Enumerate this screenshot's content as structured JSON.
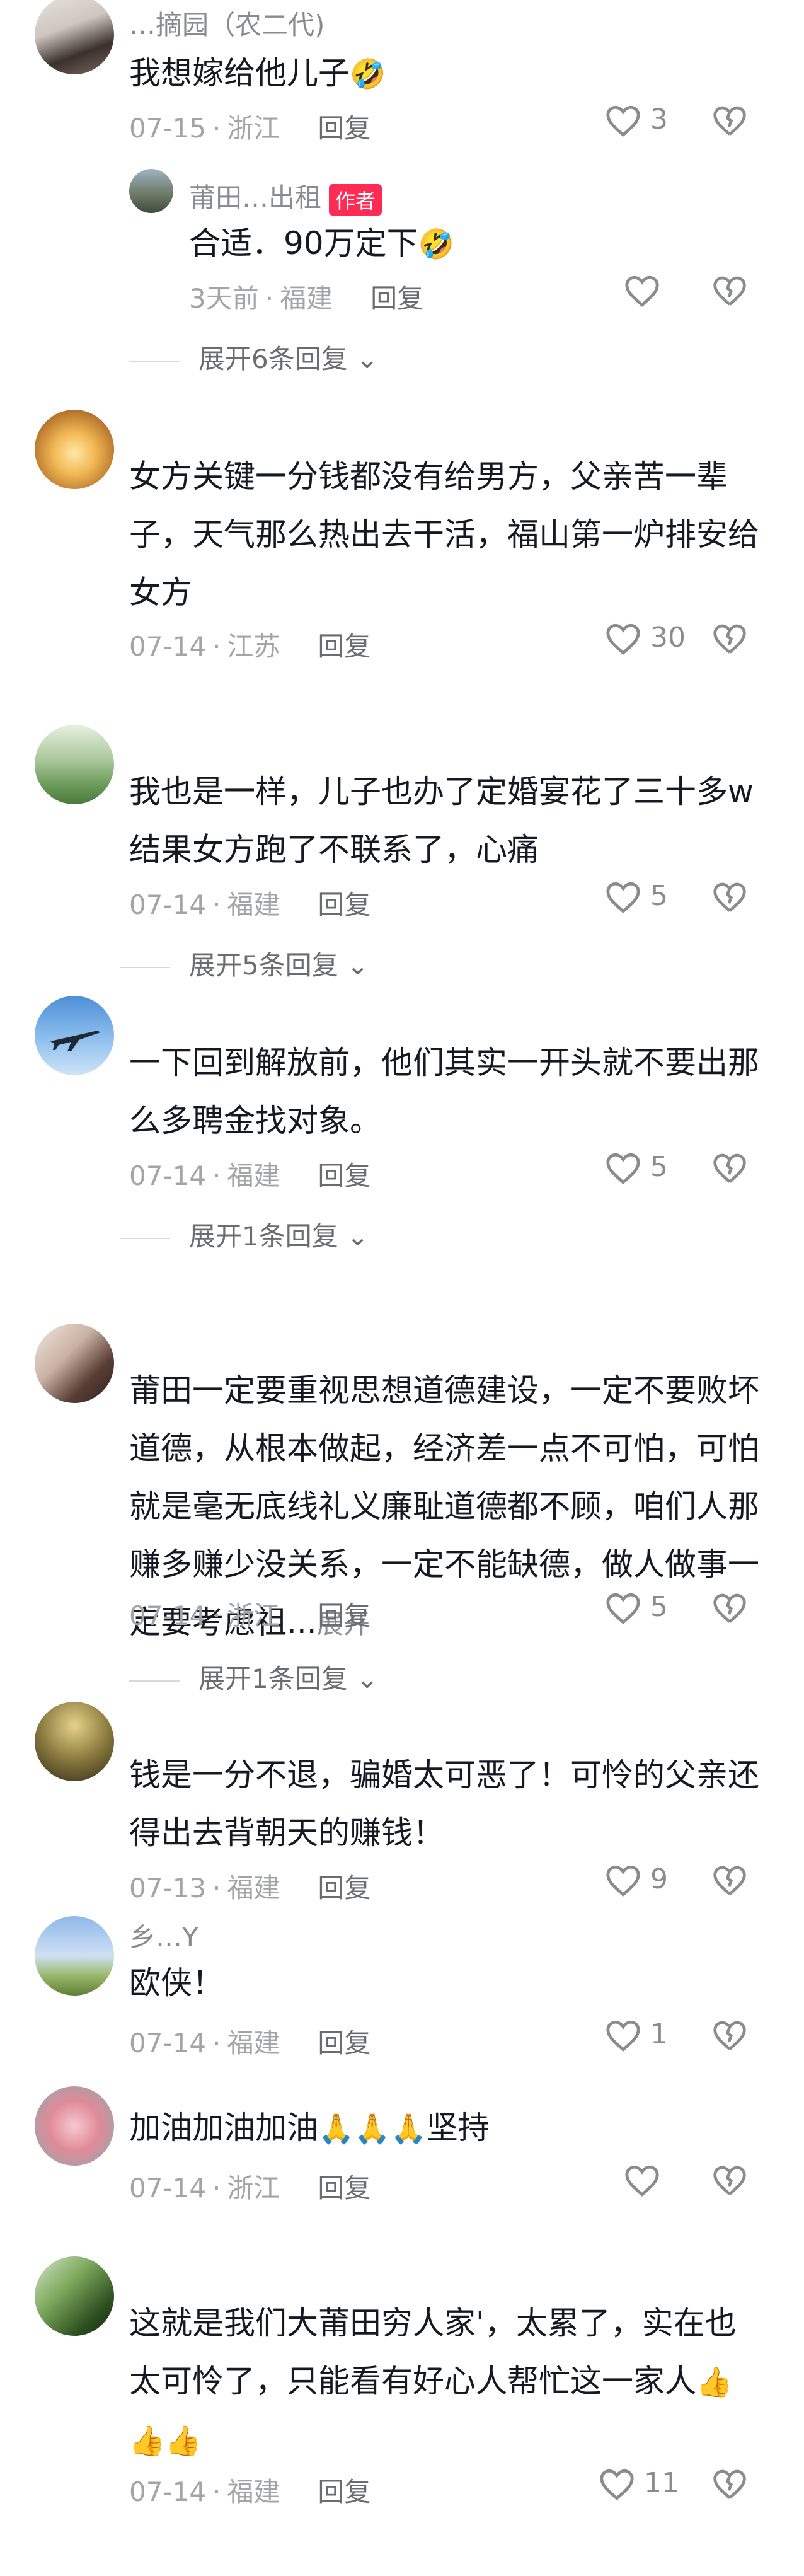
{
  "comments": [
    {
      "username": "…摘园（农二代)",
      "text": "我想嫁给他儿子",
      "emoji": "🤣",
      "date": "07-15",
      "location": "浙江",
      "reply": "回复",
      "likes": "3",
      "reply_item": {
        "username": "莆田…出租",
        "author_tag": "作者",
        "text": "合适．90万定下",
        "emoji": "🤣",
        "date": "3天前",
        "location": "福建",
        "reply": "回复"
      },
      "expand": "展开6条回复"
    },
    {
      "username": "",
      "text": "女方关键一分钱都没有给男方，父亲苦一辈子，天气那么热出去干活，福山第一炉排安给女方",
      "date": "07-14",
      "location": "江苏",
      "reply": "回复",
      "likes": "30"
    },
    {
      "username": "",
      "text": "我也是一样，儿子也办了定婚宴花了三十多w结果女方跑了不联系了，心痛",
      "date": "07-14",
      "location": "福建",
      "reply": "回复",
      "likes": "5",
      "expand": "展开5条回复"
    },
    {
      "username": "",
      "text": "一下回到解放前，他们其实一开头就不要出那么多聘金找对象。",
      "date": "07-14",
      "location": "福建",
      "reply": "回复",
      "likes": "5",
      "expand": "展开1条回复"
    },
    {
      "username": "",
      "text": "莆田一定要重视思想道德建设，一定不要败坏道德，从根本做起，经济差一点不可怕，可怕就是毫无底线礼义廉耻道德都不顾，咱们人那赚多赚少没关系，一定不能缺德，做人做事一定要考虑祖...",
      "more": "展开",
      "date": "07-14",
      "location": "浙江",
      "reply": "回复",
      "likes": "5",
      "expand": "展开1条回复"
    },
    {
      "username": "",
      "text": "钱是一分不退，骗婚太可恶了！可怜的父亲还得出去背朝天的赚钱！",
      "date": "07-13",
      "location": "福建",
      "reply": "回复",
      "likes": "9"
    },
    {
      "username": "乡…Y",
      "text": "欧侠！",
      "date": "07-14",
      "location": "福建",
      "reply": "回复",
      "likes": "1"
    },
    {
      "username": "",
      "text": "加油加油加油",
      "emoji": "🙏🙏🙏",
      "text_after": "坚持",
      "date": "07-14",
      "location": "浙江",
      "reply": "回复",
      "likes": ""
    },
    {
      "username": "",
      "text": "这就是我们大莆田穷人家'，太累了，实在也太可怜了，只能看有好心人帮忙这一家人",
      "emoji": "👍👍👍",
      "date": "07-14",
      "location": "福建",
      "reply": "回复",
      "likes": "11"
    }
  ],
  "colors": {
    "author_tag": "#fe2c55",
    "meta": "#a3a4a9",
    "text": "#161823"
  }
}
